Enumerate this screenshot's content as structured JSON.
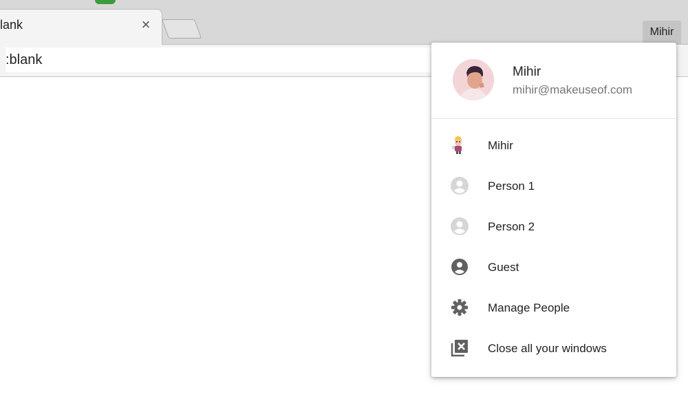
{
  "tab": {
    "title": "lank",
    "close_glyph": "×"
  },
  "toolbar": {
    "address": ":blank"
  },
  "profile_button": {
    "label": "Mihir"
  },
  "menu": {
    "header": {
      "name": "Mihir",
      "email": "mihir@makeuseof.com"
    },
    "items": [
      {
        "label": "Mihir",
        "icon": "cartoon-avatar-icon"
      },
      {
        "label": "Person 1",
        "icon": "person-avatar-icon"
      },
      {
        "label": "Person 2",
        "icon": "person-avatar-icon"
      },
      {
        "label": "Guest",
        "icon": "account-circle-icon"
      },
      {
        "label": "Manage People",
        "icon": "gear-icon"
      },
      {
        "label": "Close all your windows",
        "icon": "close-windows-icon"
      }
    ]
  },
  "colors": {
    "tabstrip": "#d8d8d8",
    "menu_icon_gray": "#616161",
    "person_avatar_gray": "#cfcfcf"
  }
}
